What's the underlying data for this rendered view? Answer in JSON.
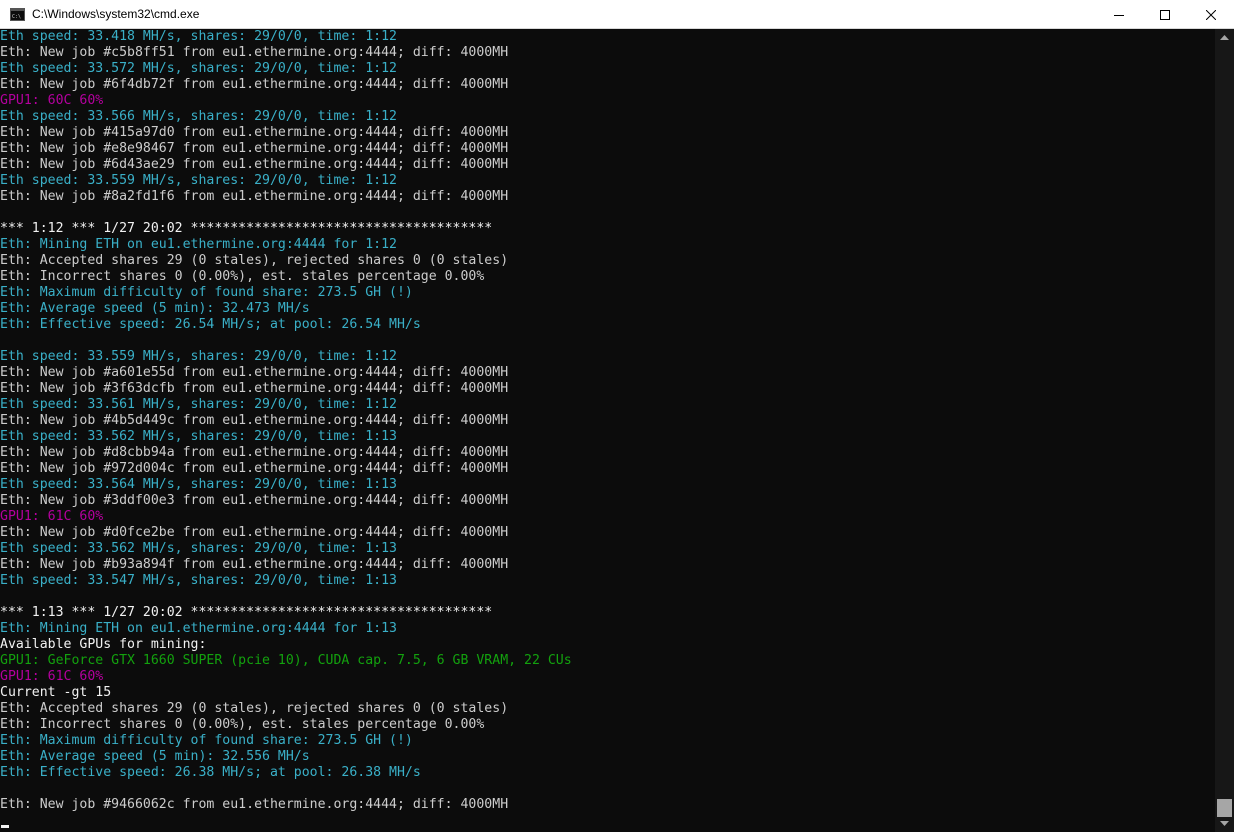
{
  "window": {
    "title": "C:\\Windows\\system32\\cmd.exe",
    "icon": "cmd-console-icon"
  },
  "controls": {
    "minimize_icon": "minimize-icon",
    "maximize_icon": "maximize-icon",
    "close_icon": "close-icon"
  },
  "colors": {
    "background": "#0c0c0c",
    "white": "#f2f2f2",
    "gray": "#cccccc",
    "cyan": "#3ab0c8",
    "magenta": "#b4009e",
    "green": "#13a10e"
  },
  "console_lines": [
    {
      "text": "Eth speed: 33.418 MH/s, shares: 29/0/0, time: 1:12",
      "color": "cyan"
    },
    {
      "text": "Eth: New job #c5b8ff51 from eu1.ethermine.org:4444; diff: 4000MH",
      "color": "gray"
    },
    {
      "text": "Eth speed: 33.572 MH/s, shares: 29/0/0, time: 1:12",
      "color": "cyan"
    },
    {
      "text": "Eth: New job #6f4db72f from eu1.ethermine.org:4444; diff: 4000MH",
      "color": "gray"
    },
    {
      "text": "GPU1: 60C 60%",
      "color": "magenta"
    },
    {
      "text": "Eth speed: 33.566 MH/s, shares: 29/0/0, time: 1:12",
      "color": "cyan"
    },
    {
      "text": "Eth: New job #415a97d0 from eu1.ethermine.org:4444; diff: 4000MH",
      "color": "gray"
    },
    {
      "text": "Eth: New job #e8e98467 from eu1.ethermine.org:4444; diff: 4000MH",
      "color": "gray"
    },
    {
      "text": "Eth: New job #6d43ae29 from eu1.ethermine.org:4444; diff: 4000MH",
      "color": "gray"
    },
    {
      "text": "Eth speed: 33.559 MH/s, shares: 29/0/0, time: 1:12",
      "color": "cyan"
    },
    {
      "text": "Eth: New job #8a2fd1f6 from eu1.ethermine.org:4444; diff: 4000MH",
      "color": "gray"
    },
    {
      "text": "",
      "color": "gray"
    },
    {
      "text": "*** 1:12 *** 1/27 20:02 **************************************",
      "color": "white"
    },
    {
      "text": "Eth: Mining ETH on eu1.ethermine.org:4444 for 1:12",
      "color": "cyan"
    },
    {
      "text": "Eth: Accepted shares 29 (0 stales), rejected shares 0 (0 stales)",
      "color": "gray"
    },
    {
      "text": "Eth: Incorrect shares 0 (0.00%), est. stales percentage 0.00%",
      "color": "gray"
    },
    {
      "text": "Eth: Maximum difficulty of found share: 273.5 GH (!)",
      "color": "cyan"
    },
    {
      "text": "Eth: Average speed (5 min): 32.473 MH/s",
      "color": "cyan"
    },
    {
      "text": "Eth: Effective speed: 26.54 MH/s; at pool: 26.54 MH/s",
      "color": "cyan"
    },
    {
      "text": "",
      "color": "gray"
    },
    {
      "text": "Eth speed: 33.559 MH/s, shares: 29/0/0, time: 1:12",
      "color": "cyan"
    },
    {
      "text": "Eth: New job #a601e55d from eu1.ethermine.org:4444; diff: 4000MH",
      "color": "gray"
    },
    {
      "text": "Eth: New job #3f63dcfb from eu1.ethermine.org:4444; diff: 4000MH",
      "color": "gray"
    },
    {
      "text": "Eth speed: 33.561 MH/s, shares: 29/0/0, time: 1:12",
      "color": "cyan"
    },
    {
      "text": "Eth: New job #4b5d449c from eu1.ethermine.org:4444; diff: 4000MH",
      "color": "gray"
    },
    {
      "text": "Eth speed: 33.562 MH/s, shares: 29/0/0, time: 1:13",
      "color": "cyan"
    },
    {
      "text": "Eth: New job #d8cbb94a from eu1.ethermine.org:4444; diff: 4000MH",
      "color": "gray"
    },
    {
      "text": "Eth: New job #972d004c from eu1.ethermine.org:4444; diff: 4000MH",
      "color": "gray"
    },
    {
      "text": "Eth speed: 33.564 MH/s, shares: 29/0/0, time: 1:13",
      "color": "cyan"
    },
    {
      "text": "Eth: New job #3ddf00e3 from eu1.ethermine.org:4444; diff: 4000MH",
      "color": "gray"
    },
    {
      "text": "GPU1: 61C 60%",
      "color": "magenta"
    },
    {
      "text": "Eth: New job #d0fce2be from eu1.ethermine.org:4444; diff: 4000MH",
      "color": "gray"
    },
    {
      "text": "Eth speed: 33.562 MH/s, shares: 29/0/0, time: 1:13",
      "color": "cyan"
    },
    {
      "text": "Eth: New job #b93a894f from eu1.ethermine.org:4444; diff: 4000MH",
      "color": "gray"
    },
    {
      "text": "Eth speed: 33.547 MH/s, shares: 29/0/0, time: 1:13",
      "color": "cyan"
    },
    {
      "text": "",
      "color": "gray"
    },
    {
      "text": "*** 1:13 *** 1/27 20:02 **************************************",
      "color": "white"
    },
    {
      "text": "Eth: Mining ETH on eu1.ethermine.org:4444 for 1:13",
      "color": "cyan"
    },
    {
      "text": "Available GPUs for mining:",
      "color": "white"
    },
    {
      "text": "GPU1: GeForce GTX 1660 SUPER (pcie 10), CUDA cap. 7.5, 6 GB VRAM, 22 CUs",
      "color": "green"
    },
    {
      "text": "GPU1: 61C 60%",
      "color": "magenta"
    },
    {
      "text": "Current -gt 15",
      "color": "white"
    },
    {
      "text": "Eth: Accepted shares 29 (0 stales), rejected shares 0 (0 stales)",
      "color": "gray"
    },
    {
      "text": "Eth: Incorrect shares 0 (0.00%), est. stales percentage 0.00%",
      "color": "gray"
    },
    {
      "text": "Eth: Maximum difficulty of found share: 273.5 GH (!)",
      "color": "cyan"
    },
    {
      "text": "Eth: Average speed (5 min): 32.556 MH/s",
      "color": "cyan"
    },
    {
      "text": "Eth: Effective speed: 26.38 MH/s; at pool: 26.38 MH/s",
      "color": "cyan"
    },
    {
      "text": "",
      "color": "gray"
    },
    {
      "text": "Eth: New job #9466062c from eu1.ethermine.org:4444; diff: 4000MH",
      "color": "gray"
    }
  ]
}
